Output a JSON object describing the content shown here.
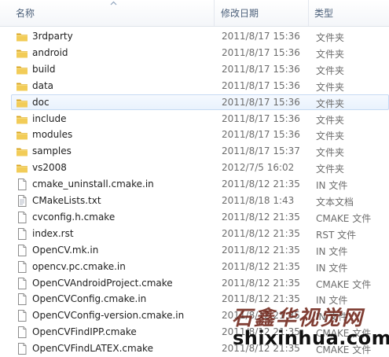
{
  "columns": {
    "name": "名称",
    "date": "修改日期",
    "type": "类型"
  },
  "rows": [
    {
      "name": "3rdparty",
      "date": "2011/8/17 15:36",
      "type": "文件夹",
      "kind": "folder"
    },
    {
      "name": "android",
      "date": "2011/8/17 15:36",
      "type": "文件夹",
      "kind": "folder"
    },
    {
      "name": "build",
      "date": "2011/8/17 15:36",
      "type": "文件夹",
      "kind": "folder"
    },
    {
      "name": "data",
      "date": "2011/8/17 15:36",
      "type": "文件夹",
      "kind": "folder"
    },
    {
      "name": "doc",
      "date": "2011/8/17 15:36",
      "type": "文件夹",
      "kind": "folder",
      "hover": true
    },
    {
      "name": "include",
      "date": "2011/8/17 15:36",
      "type": "文件夹",
      "kind": "folder"
    },
    {
      "name": "modules",
      "date": "2011/8/17 15:36",
      "type": "文件夹",
      "kind": "folder"
    },
    {
      "name": "samples",
      "date": "2011/8/17 15:37",
      "type": "文件夹",
      "kind": "folder"
    },
    {
      "name": "vs2008",
      "date": "2012/7/5 16:02",
      "type": "文件夹",
      "kind": "folder"
    },
    {
      "name": "cmake_uninstall.cmake.in",
      "date": "2011/8/12 21:35",
      "type": "IN 文件",
      "kind": "file"
    },
    {
      "name": "CMakeLists.txt",
      "date": "2011/8/18 1:43",
      "type": "文本文档",
      "kind": "text"
    },
    {
      "name": "cvconfig.h.cmake",
      "date": "2011/8/12 21:35",
      "type": "CMAKE 文件",
      "kind": "file"
    },
    {
      "name": "index.rst",
      "date": "2011/8/12 21:35",
      "type": "RST 文件",
      "kind": "file"
    },
    {
      "name": "OpenCV.mk.in",
      "date": "2011/8/12 21:35",
      "type": "IN 文件",
      "kind": "file"
    },
    {
      "name": "opencv.pc.cmake.in",
      "date": "2011/8/12 21:35",
      "type": "IN 文件",
      "kind": "file"
    },
    {
      "name": "OpenCVAndroidProject.cmake",
      "date": "2011/8/12 21:35",
      "type": "CMAKE 文件",
      "kind": "file"
    },
    {
      "name": "OpenCVConfig.cmake.in",
      "date": "2011/8/12 21:35",
      "type": "IN 文件",
      "kind": "file"
    },
    {
      "name": "OpenCVConfig-version.cmake.in",
      "date": "2011/8/12 21:35",
      "type": "IN 文件",
      "kind": "file"
    },
    {
      "name": "OpenCVFindIPP.cmake",
      "date": "2011/8/12 21:35",
      "type": "CMAKE 文件",
      "kind": "file"
    },
    {
      "name": "OpenCVFindLATEX.cmake",
      "date": "2011/8/12 21:35",
      "type": "CMAKE 文件",
      "kind": "file"
    }
  ],
  "watermark": {
    "brush_text": "石鑫华视觉网",
    "site": "shixinhua.com"
  },
  "icons": {
    "folder": "folder-icon",
    "file": "file-icon",
    "text": "text-document-icon",
    "sort": "sort-arrow-icon"
  },
  "colors": {
    "folder": "#e8b93c",
    "header_text": "#4c607a",
    "meta_text": "#6d6d6d",
    "hover_border": "#c6daf3"
  }
}
